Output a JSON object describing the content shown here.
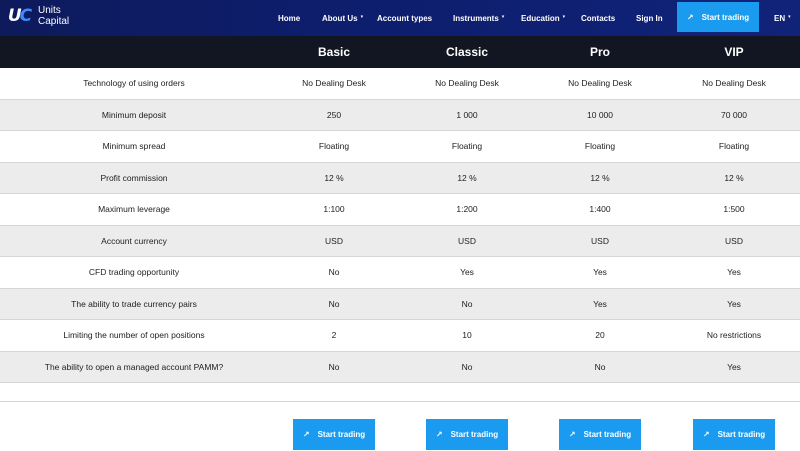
{
  "brand": {
    "mark_u": "U",
    "mark_c": "C",
    "name_line1": "Units",
    "name_line2": "Capital"
  },
  "nav": {
    "items": [
      {
        "label": "Home",
        "has_dropdown": false
      },
      {
        "label": "About Us",
        "has_dropdown": true
      },
      {
        "label": "Account types",
        "has_dropdown": false
      },
      {
        "label": "Instruments",
        "has_dropdown": true
      },
      {
        "label": "Education",
        "has_dropdown": true
      },
      {
        "label": "Contacts",
        "has_dropdown": false
      },
      {
        "label": "Sign In",
        "has_dropdown": false
      }
    ],
    "cta_label": "Start trading",
    "language": "EN",
    "dropdown_caret": "▾",
    "arrow_glyph": "↗"
  },
  "plans": [
    "Basic",
    "Classic",
    "Pro",
    "VIP"
  ],
  "rows": [
    {
      "label": "Technology of using orders",
      "values": [
        "No Dealing Desk",
        "No Dealing Desk",
        "No Dealing Desk",
        "No Dealing Desk"
      ]
    },
    {
      "label": "Minimum deposit",
      "values": [
        "250",
        "1 000",
        "10 000",
        "70 000"
      ]
    },
    {
      "label": "Minimum spread",
      "values": [
        "Floating",
        "Floating",
        "Floating",
        "Floating"
      ]
    },
    {
      "label": "Profit commission",
      "values": [
        "12 %",
        "12 %",
        "12 %",
        "12 %"
      ]
    },
    {
      "label": "Maximum leverage",
      "values": [
        "1:100",
        "1:200",
        "1:400",
        "1:500"
      ]
    },
    {
      "label": "Account currency",
      "values": [
        "USD",
        "USD",
        "USD",
        "USD"
      ]
    },
    {
      "label": "CFD trading opportunity",
      "values": [
        "No",
        "Yes",
        "Yes",
        "Yes"
      ]
    },
    {
      "label": "The ability to trade currency pairs",
      "values": [
        "No",
        "No",
        "Yes",
        "Yes"
      ]
    },
    {
      "label": "Limiting the number of open positions",
      "values": [
        "2",
        "10",
        "20",
        "No restrictions"
      ]
    },
    {
      "label": "The ability to open a managed account PAMM?",
      "values": [
        "No",
        "No",
        "No",
        "Yes"
      ]
    }
  ],
  "buttons": {
    "start_trading_label": "Start trading"
  },
  "colors": {
    "navbar": "#0e1e6e",
    "header_row": "#111622",
    "accent": "#1a9bf0",
    "row_alt": "#ececec"
  }
}
